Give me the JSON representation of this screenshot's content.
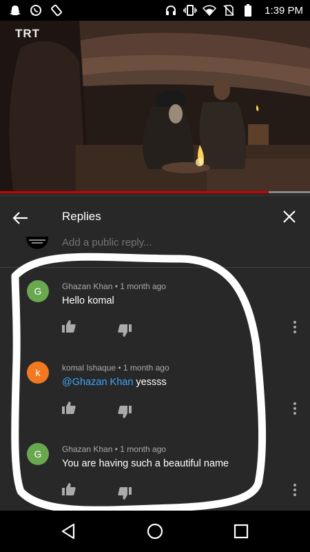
{
  "status_bar": {
    "time": "1:39 PM",
    "left_icons": [
      "snapchat-icon",
      "whatsapp-icon",
      "screen-rotation-icon"
    ],
    "right_icons": [
      "headset-icon",
      "vibrate-icon",
      "wifi-icon",
      "no-sim-icon",
      "battery-icon"
    ]
  },
  "video": {
    "logo": "TRT",
    "accent": "#cc0000"
  },
  "header": {
    "title": "Replies"
  },
  "compose": {
    "placeholder": "Add a public reply..."
  },
  "comments": [
    {
      "avatar_letter": "G",
      "avatar_color": "#6aa84f",
      "author": "Ghazan Khan",
      "age": "1 month ago",
      "text": "Hello komal"
    },
    {
      "avatar_letter": "k",
      "avatar_color": "#f4781f",
      "author": "komal Ishaque",
      "age": "1 month ago",
      "mention": "@Ghazan Khan",
      "text": " yessss"
    },
    {
      "avatar_letter": "G",
      "avatar_color": "#6aa84f",
      "author": "Ghazan Khan",
      "age": "1 month ago",
      "text": "You are having such a beautiful name"
    }
  ],
  "meta_separator": " • ",
  "nav": {
    "buttons": [
      "back-triangle-icon",
      "home-circle-icon",
      "recents-square-icon"
    ]
  }
}
